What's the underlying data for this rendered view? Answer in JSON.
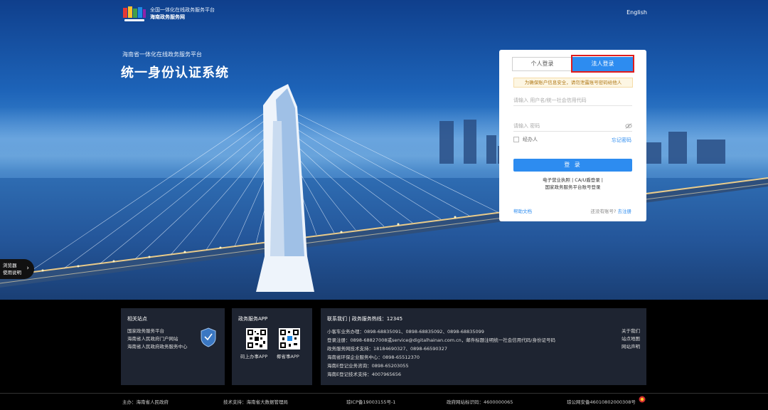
{
  "header": {
    "logo_line1": "全国一体化在线政务服务平台",
    "logo_line2": "海南政务服务网",
    "language": "English"
  },
  "hero": {
    "subtitle": "海南省一体化在线政务服务平台",
    "title": "统一身份认证系统"
  },
  "side_tab": {
    "line1": "浏览器",
    "line2": "使用说明",
    "arrow": "›"
  },
  "login": {
    "tabs": [
      {
        "label": "个人登录",
        "active": false
      },
      {
        "label": "法人登录",
        "active": true
      }
    ],
    "notice": "为确保账户信息安全，请勿泄露账号密码给他人",
    "username_placeholder": "请输入 用户名/统一社会信用代码",
    "password_placeholder": "请输入 密码",
    "agent_label": "经办人",
    "forgot_label": "忘记密码",
    "submit_label": "登 录",
    "alt_line1": "电子营业执照 | CA/U盾登录 |",
    "alt_line2": "国家政务服务平台账号登录",
    "help_label": "帮助文档",
    "no_account": "还没有账号?",
    "register_label": "去注册"
  },
  "footer": {
    "related": {
      "title": "相关站点",
      "links": [
        "国家政务服务平台",
        "海南省人民政府门户网站",
        "海南省人民政府政务服务中心"
      ]
    },
    "app": {
      "title": "政务服务APP",
      "apps": [
        "码上办事APP",
        "椰省事APP"
      ]
    },
    "contact": {
      "title": "联系我们 | 政务服务热线：12345",
      "lines": [
        "小客车业务办理：0898-68835091、0898-68835092、0898-68835099",
        "登录注册：0898-68827008或service@digitalhainan.com.cn，邮件标题注明统一社会信用代码/身份证号码",
        "政务服务网技术支持：18184690327、0898-66590327",
        "海南省环保企业服务中心：0898-65512370",
        "海南E登记业务咨询：0898-65203055",
        "海南E登记技术支持：4007965656"
      ],
      "links": [
        "关于我们",
        "站点地图",
        "网站声明"
      ]
    },
    "bottom": {
      "host": "主办：海南省人民政府",
      "tech": "技术支持：海南省大数据管理局",
      "icp": "琼ICP备19003155号-1",
      "gov_id": "政府网站标识码：4600000065",
      "police": "琼公网安备46010802000308号"
    }
  },
  "colors": {
    "accent": "#2d8cf0",
    "highlight": "#e01c1c",
    "footer_box": "#1e2431"
  }
}
